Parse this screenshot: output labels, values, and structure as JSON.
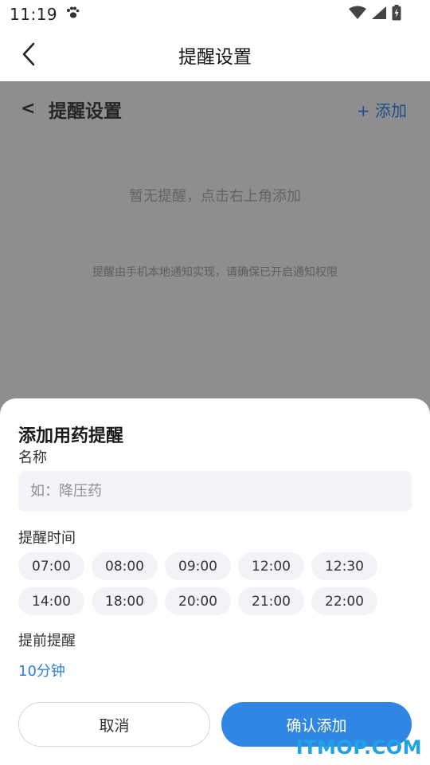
{
  "status_bar": {
    "time": "11:19",
    "icons": [
      "paw-icon",
      "wifi-icon",
      "signal-icon",
      "battery-charging-icon"
    ]
  },
  "header": {
    "title": "提醒设置",
    "back_icon": "chevron-left-icon"
  },
  "background_page": {
    "back_label": "<",
    "title": "提醒设置",
    "add_label": "+ 添加",
    "empty_text": "暂无提醒，点击右上角添加",
    "notice_text": "提醒由手机本地通知实现，请确保已开启通知权限"
  },
  "sheet": {
    "title": "添加用药提醒",
    "name_label": "名称",
    "name_value": "",
    "name_placeholder": "如：降压药",
    "time_label": "提醒时间",
    "time_options": [
      "07:00",
      "08:00",
      "09:00",
      "12:00",
      "12:30",
      "14:00",
      "18:00",
      "20:00",
      "21:00",
      "22:00"
    ],
    "advance_label": "提前提醒",
    "advance_value": "10分钟",
    "cancel_label": "取消",
    "confirm_label": "确认添加"
  },
  "watermark": "ITMOP.COM",
  "colors": {
    "accent": "#2f86e3",
    "link": "#2f7fd9",
    "overlay": "#8e8e90",
    "chip_bg": "#f2f3f6",
    "watermark": "#1ea2e8"
  }
}
